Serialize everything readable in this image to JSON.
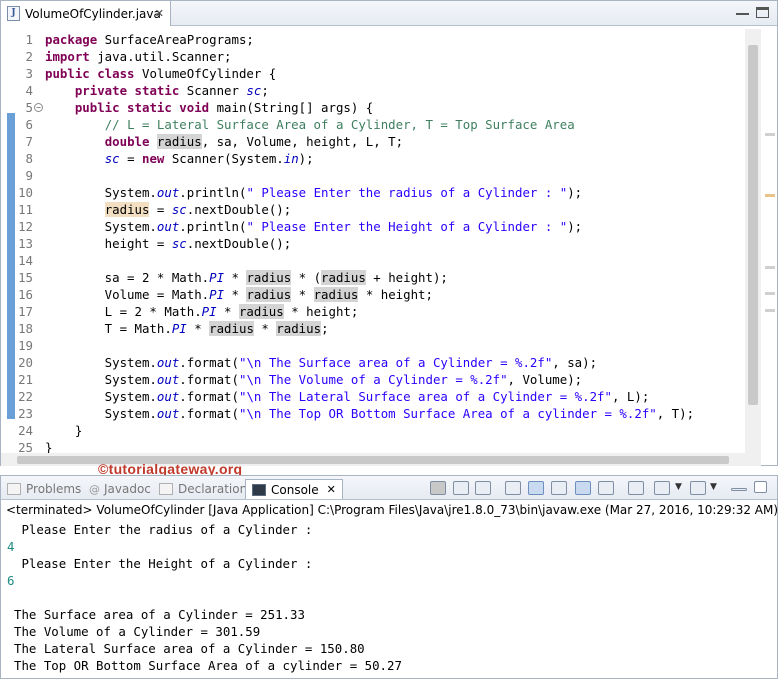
{
  "editor": {
    "tab_label": "VolumeOfCylinder.java",
    "close_glyph": "✕",
    "file_icon_glyph": "J",
    "lines": [
      {
        "n": "1",
        "segs": [
          {
            "t": "package",
            "c": "kw"
          },
          {
            "t": " SurfaceAreaPrograms;",
            "c": ""
          }
        ]
      },
      {
        "n": "2",
        "segs": [
          {
            "t": "import",
            "c": "kw"
          },
          {
            "t": " java.util.Scanner;",
            "c": ""
          }
        ]
      },
      {
        "n": "3",
        "segs": [
          {
            "t": "public class",
            "c": "kw"
          },
          {
            "t": " VolumeOfCylinder {",
            "c": ""
          }
        ]
      },
      {
        "n": "4",
        "segs": [
          {
            "t": "    ",
            "c": ""
          },
          {
            "t": "private static",
            "c": "kw"
          },
          {
            "t": " Scanner ",
            "c": ""
          },
          {
            "t": "sc",
            "c": "fld"
          },
          {
            "t": ";",
            "c": ""
          }
        ]
      },
      {
        "n": "5",
        "fold": "−",
        "segs": [
          {
            "t": "    ",
            "c": ""
          },
          {
            "t": "public static void",
            "c": "kw"
          },
          {
            "t": " main(String[] args) {",
            "c": ""
          }
        ]
      },
      {
        "n": "6",
        "segs": [
          {
            "t": "        ",
            "c": ""
          },
          {
            "t": "// L = Lateral Surface Area of a Cylinder, T = Top Surface Area",
            "c": "cm"
          }
        ]
      },
      {
        "n": "7",
        "segs": [
          {
            "t": "        ",
            "c": ""
          },
          {
            "t": "double",
            "c": "kw"
          },
          {
            "t": " ",
            "c": ""
          },
          {
            "t": "radius",
            "c": "occ"
          },
          {
            "t": ", sa, Volume, height, L, T;",
            "c": ""
          }
        ]
      },
      {
        "n": "8",
        "segs": [
          {
            "t": "        ",
            "c": ""
          },
          {
            "t": "sc",
            "c": "fld"
          },
          {
            "t": " = ",
            "c": ""
          },
          {
            "t": "new",
            "c": "kw"
          },
          {
            "t": " Scanner(System.",
            "c": ""
          },
          {
            "t": "in",
            "c": "fld"
          },
          {
            "t": ");",
            "c": ""
          }
        ]
      },
      {
        "n": "9",
        "segs": []
      },
      {
        "n": "10",
        "segs": [
          {
            "t": "        System.",
            "c": ""
          },
          {
            "t": "out",
            "c": "fld"
          },
          {
            "t": ".println(",
            "c": ""
          },
          {
            "t": "\" Please Enter the radius of a Cylinder : \"",
            "c": "st"
          },
          {
            "t": ");",
            "c": ""
          }
        ]
      },
      {
        "n": "11",
        "segs": [
          {
            "t": "        ",
            "c": ""
          },
          {
            "t": "radius",
            "c": "occw"
          },
          {
            "t": " = ",
            "c": ""
          },
          {
            "t": "sc",
            "c": "fld"
          },
          {
            "t": ".nextDouble();",
            "c": ""
          }
        ]
      },
      {
        "n": "12",
        "segs": [
          {
            "t": "        System.",
            "c": ""
          },
          {
            "t": "out",
            "c": "fld"
          },
          {
            "t": ".println(",
            "c": ""
          },
          {
            "t": "\" Please Enter the Height of a Cylinder : \"",
            "c": "st"
          },
          {
            "t": ");",
            "c": ""
          }
        ]
      },
      {
        "n": "13",
        "segs": [
          {
            "t": "        height = ",
            "c": ""
          },
          {
            "t": "sc",
            "c": "fld"
          },
          {
            "t": ".nextDouble();",
            "c": ""
          }
        ]
      },
      {
        "n": "14",
        "segs": []
      },
      {
        "n": "15",
        "segs": [
          {
            "t": "        sa = 2 * Math.",
            "c": ""
          },
          {
            "t": "PI",
            "c": "fld"
          },
          {
            "t": " * ",
            "c": ""
          },
          {
            "t": "radius",
            "c": "occ"
          },
          {
            "t": " * (",
            "c": ""
          },
          {
            "t": "radius",
            "c": "occ"
          },
          {
            "t": " + height);",
            "c": ""
          }
        ]
      },
      {
        "n": "16",
        "segs": [
          {
            "t": "        Volume = Math.",
            "c": ""
          },
          {
            "t": "PI",
            "c": "fld"
          },
          {
            "t": " * ",
            "c": ""
          },
          {
            "t": "radius",
            "c": "occ"
          },
          {
            "t": " * ",
            "c": ""
          },
          {
            "t": "radius",
            "c": "occ"
          },
          {
            "t": " * height;",
            "c": ""
          }
        ]
      },
      {
        "n": "17",
        "segs": [
          {
            "t": "        L = 2 * Math.",
            "c": ""
          },
          {
            "t": "PI",
            "c": "fld"
          },
          {
            "t": " * ",
            "c": ""
          },
          {
            "t": "radius",
            "c": "occ"
          },
          {
            "t": " * height;",
            "c": ""
          }
        ]
      },
      {
        "n": "18",
        "segs": [
          {
            "t": "        T = Math.",
            "c": ""
          },
          {
            "t": "PI",
            "c": "fld"
          },
          {
            "t": " * ",
            "c": ""
          },
          {
            "t": "radius",
            "c": "occ"
          },
          {
            "t": " * ",
            "c": ""
          },
          {
            "t": "radius",
            "c": "occ"
          },
          {
            "t": ";",
            "c": ""
          }
        ]
      },
      {
        "n": "19",
        "segs": []
      },
      {
        "n": "20",
        "segs": [
          {
            "t": "        System.",
            "c": ""
          },
          {
            "t": "out",
            "c": "fld"
          },
          {
            "t": ".format(",
            "c": ""
          },
          {
            "t": "\"\\n The Surface area of a Cylinder = %.2f\"",
            "c": "st"
          },
          {
            "t": ", sa);",
            "c": ""
          }
        ]
      },
      {
        "n": "21",
        "segs": [
          {
            "t": "        System.",
            "c": ""
          },
          {
            "t": "out",
            "c": "fld"
          },
          {
            "t": ".format(",
            "c": ""
          },
          {
            "t": "\"\\n The Volume of a Cylinder = %.2f\"",
            "c": "st"
          },
          {
            "t": ", Volume);",
            "c": ""
          }
        ]
      },
      {
        "n": "22",
        "segs": [
          {
            "t": "        System.",
            "c": ""
          },
          {
            "t": "out",
            "c": "fld"
          },
          {
            "t": ".format(",
            "c": ""
          },
          {
            "t": "\"\\n The Lateral Surface area of a Cylinder = %.2f\"",
            "c": "st"
          },
          {
            "t": ", L);",
            "c": ""
          }
        ]
      },
      {
        "n": "23",
        "segs": [
          {
            "t": "        System.",
            "c": ""
          },
          {
            "t": "out",
            "c": "fld"
          },
          {
            "t": ".format(",
            "c": ""
          },
          {
            "t": "\"\\n The Top OR Bottom Surface Area of a cylinder = %.2f\"",
            "c": "st"
          },
          {
            "t": ", T);",
            "c": ""
          }
        ]
      },
      {
        "n": "24",
        "segs": [
          {
            "t": "    }",
            "c": ""
          }
        ]
      },
      {
        "n": "25",
        "segs": [
          {
            "t": "}",
            "c": ""
          }
        ]
      }
    ]
  },
  "watermark": "©tutorialgateway.org",
  "views": {
    "tabs": [
      {
        "label": "Problems",
        "active": false
      },
      {
        "label": "Javadoc",
        "active": false
      },
      {
        "label": "Declaration",
        "active": false
      },
      {
        "label": "Console",
        "active": true
      }
    ],
    "close_glyph": "✕"
  },
  "console": {
    "terminated": "<terminated> VolumeOfCylinder [Java Application] C:\\Program Files\\Java\\jre1.8.0_73\\bin\\javaw.exe (Mar 27, 2016, 10:29:32 AM)",
    "output": [
      {
        "text": " Please Enter the radius of a Cylinder :",
        "input": false
      },
      {
        "text": "4",
        "input": true
      },
      {
        "text": " Please Enter the Height of a Cylinder :",
        "input": false
      },
      {
        "text": "6",
        "input": true
      },
      {
        "text": "",
        "input": false
      },
      {
        "text": "The Surface area of a Cylinder = 251.33",
        "input": false
      },
      {
        "text": "The Volume of a Cylinder = 301.59",
        "input": false
      },
      {
        "text": "The Lateral Surface area of a Cylinder = 150.80",
        "input": false
      },
      {
        "text": "The Top OR Bottom Surface Area of a cylinder = 50.27",
        "input": false
      }
    ]
  },
  "colors": {
    "keyword": "#7f0055",
    "comment": "#3f7f5f",
    "string": "#2a00ff",
    "field": "#0000c0",
    "console_input": "#1f8a80",
    "watermark": "#c0392b"
  }
}
